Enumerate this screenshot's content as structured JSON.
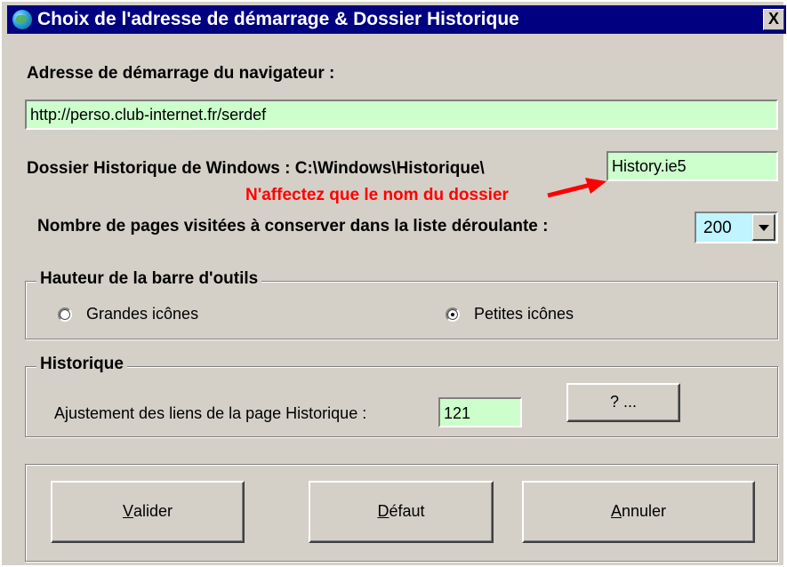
{
  "window": {
    "title": "Choix de l'adresse de démarrage & Dossier Historique",
    "close_label": "X"
  },
  "startup": {
    "label": "Adresse de démarrage du navigateur :",
    "url": "http://perso.club-internet.fr/serdef"
  },
  "history_folder": {
    "label": "Dossier Historique de Windows : C:\\Windows\\Historique\\",
    "value": "History.ie5",
    "hint": "N'affectez que le nom du dossier"
  },
  "pages": {
    "label": "Nombre de pages visitées à conserver dans la liste déroulante :",
    "value": "200"
  },
  "toolbar_group": {
    "legend": "Hauteur de la barre d'outils",
    "option_large": "Grandes icônes",
    "option_small": "Petites icônes",
    "selected": "Petites icônes"
  },
  "history_group": {
    "legend": "Historique",
    "adjust_label": "Ajustement des liens de la page Historique :",
    "adjust_value": "121",
    "help_button": "? ..."
  },
  "buttons": {
    "validate_key": "V",
    "validate_rest": "alider",
    "default_key": "D",
    "default_rest": "éfaut",
    "cancel_key": "A",
    "cancel_rest": "nnuler"
  },
  "colors": {
    "titlebar": "#000080",
    "field_bg": "#ccffcc",
    "combo_bg": "#c0f4ff",
    "hint": "#ff0000",
    "window_bg": "#d4d0c8"
  }
}
